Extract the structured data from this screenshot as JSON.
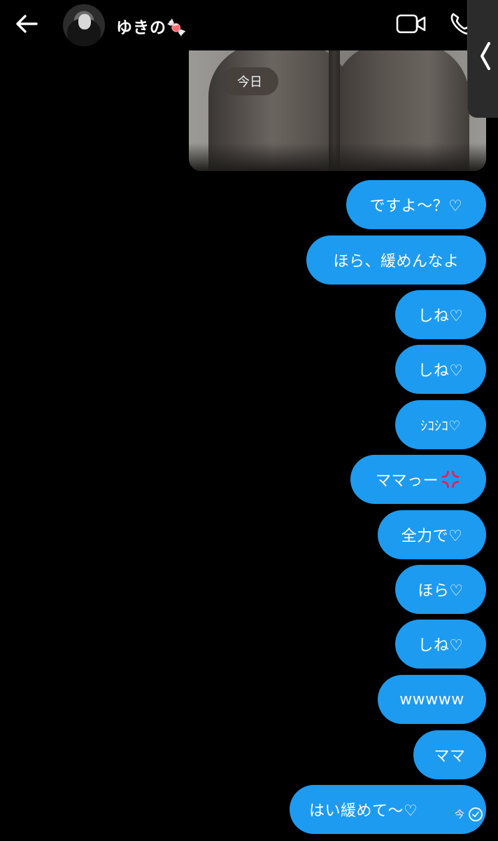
{
  "header": {
    "contact_name": "ゆきの🍬",
    "back_icon": "arrow-left-icon",
    "video_icon": "video-camera-icon",
    "call_icon": "phone-icon"
  },
  "side_handle": {
    "icon": "chevron-left-icon"
  },
  "date_divider": "今日",
  "messages": [
    {
      "text": "ですよ～？♡"
    },
    {
      "text": "ほら、緩めんなよ"
    },
    {
      "text": "しね♡"
    },
    {
      "text": "しね♡"
    },
    {
      "text": "ｼｺｼｺ♡"
    },
    {
      "text": "ママっー",
      "emoji": "anger-icon"
    },
    {
      "text": "全力で♡"
    },
    {
      "text": "ほら♡"
    },
    {
      "text": "しね♡"
    },
    {
      "text": "wwwww"
    },
    {
      "text": "ママ"
    },
    {
      "text": "はい緩めて～♡"
    }
  ],
  "last_message_status": {
    "time": "今",
    "read_icon": "check-circle-icon"
  },
  "colors": {
    "background": "#000000",
    "bubble": "#1d9bf0",
    "text": "#ffffff",
    "date_chip": "#46403c"
  }
}
